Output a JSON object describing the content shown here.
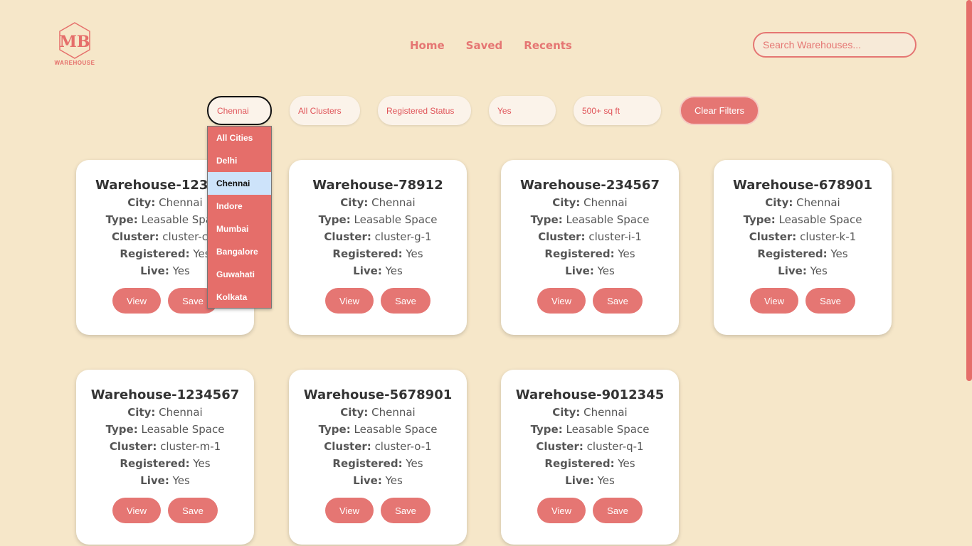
{
  "brand": {
    "logo_text": "WAREHOUSE",
    "accent": "#e57673"
  },
  "nav": {
    "home": "Home",
    "saved": "Saved",
    "recents": "Recents"
  },
  "search": {
    "placeholder": "Search Warehouses..."
  },
  "filters": {
    "city": "Chennai",
    "cluster": "All Clusters",
    "registered": "Registered Status",
    "live": "Yes",
    "size": "500+ sq ft",
    "clear_label": "Clear Filters"
  },
  "city_dropdown": {
    "options": [
      "All Cities",
      "Delhi",
      "Chennai",
      "Indore",
      "Mumbai",
      "Bangalore",
      "Guwahati",
      "Kolkata"
    ],
    "selected": "Chennai"
  },
  "labels": {
    "city": "City:",
    "type": "Type:",
    "cluster": "Cluster:",
    "registered": "Registered:",
    "live": "Live:",
    "view": "View",
    "save": "Save"
  },
  "warehouses": [
    {
      "name": "Warehouse-123456",
      "city": "Chennai",
      "type": "Leasable Space",
      "cluster": "cluster-c-1",
      "registered": "Yes",
      "live": "Yes"
    },
    {
      "name": "Warehouse-78912",
      "city": "Chennai",
      "type": "Leasable Space",
      "cluster": "cluster-g-1",
      "registered": "Yes",
      "live": "Yes"
    },
    {
      "name": "Warehouse-234567",
      "city": "Chennai",
      "type": "Leasable Space",
      "cluster": "cluster-i-1",
      "registered": "Yes",
      "live": "Yes"
    },
    {
      "name": "Warehouse-678901",
      "city": "Chennai",
      "type": "Leasable Space",
      "cluster": "cluster-k-1",
      "registered": "Yes",
      "live": "Yes"
    },
    {
      "name": "Warehouse-1234567",
      "city": "Chennai",
      "type": "Leasable Space",
      "cluster": "cluster-m-1",
      "registered": "Yes",
      "live": "Yes"
    },
    {
      "name": "Warehouse-5678901",
      "city": "Chennai",
      "type": "Leasable Space",
      "cluster": "cluster-o-1",
      "registered": "Yes",
      "live": "Yes"
    },
    {
      "name": "Warehouse-9012345",
      "city": "Chennai",
      "type": "Leasable Space",
      "cluster": "cluster-q-1",
      "registered": "Yes",
      "live": "Yes"
    }
  ]
}
